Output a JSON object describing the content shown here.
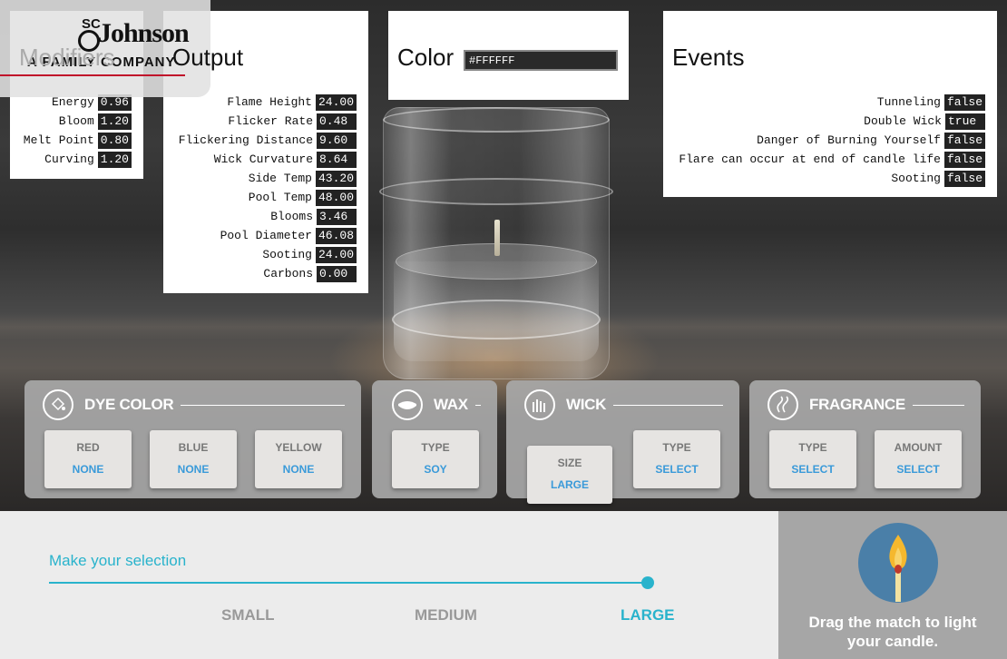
{
  "logo": {
    "sc": "SC",
    "brand": "Johnson",
    "tagline": "A FAMILY COMPANY"
  },
  "modifiers": {
    "title": "Modifiers",
    "rows": [
      {
        "label": "Energy",
        "value": "0.96"
      },
      {
        "label": "Bloom",
        "value": "1.20"
      },
      {
        "label": "Melt Point",
        "value": "0.80"
      },
      {
        "label": "Curving",
        "value": "1.20"
      }
    ]
  },
  "output": {
    "title": "Output",
    "rows": [
      {
        "label": "Flame Height",
        "value": "24.00"
      },
      {
        "label": "Flicker Rate",
        "value": "0.48"
      },
      {
        "label": "Flickering Distance",
        "value": "9.60"
      },
      {
        "label": "Wick Curvature",
        "value": "8.64"
      },
      {
        "label": "Side Temp",
        "value": "43.20"
      },
      {
        "label": "Pool Temp",
        "value": "48.00"
      },
      {
        "label": "Blooms",
        "value": "3.46"
      },
      {
        "label": "Pool Diameter",
        "value": "46.08"
      },
      {
        "label": "Sooting",
        "value": "24.00"
      },
      {
        "label": "Carbons",
        "value": "0.00"
      }
    ]
  },
  "color": {
    "title": "Color",
    "value": "#FFFFFF"
  },
  "events": {
    "title": "Events",
    "rows": [
      {
        "label": "Tunneling",
        "value": "false"
      },
      {
        "label": "Double Wick",
        "value": "true"
      },
      {
        "label": "Danger of Burning Yourself",
        "value": "false"
      },
      {
        "label": "Flare can occur at end of candle life",
        "value": "false"
      },
      {
        "label": "Sooting",
        "value": "false"
      }
    ]
  },
  "cards": {
    "dye": {
      "title": "DYE COLOR",
      "icon": "paint-bucket-icon",
      "options": [
        {
          "key": "RED",
          "value": "NONE"
        },
        {
          "key": "BLUE",
          "value": "NONE"
        },
        {
          "key": "YELLOW",
          "value": "NONE"
        }
      ]
    },
    "wax": {
      "title": "WAX",
      "icon": "wax-bowl-icon",
      "options": [
        {
          "key": "TYPE",
          "value": "SOY"
        }
      ]
    },
    "wick": {
      "title": "WICK",
      "icon": "wick-icon",
      "options": [
        {
          "key": "SIZE",
          "value": "LARGE"
        },
        {
          "key": "TYPE",
          "value": "SELECT"
        }
      ]
    },
    "fragrance": {
      "title": "FRAGRANCE",
      "icon": "fragrance-icon",
      "options": [
        {
          "key": "TYPE",
          "value": "SELECT"
        },
        {
          "key": "AMOUNT",
          "value": "SELECT"
        }
      ]
    }
  },
  "selector": {
    "prompt": "Make your selection",
    "sizes": [
      "SMALL",
      "MEDIUM",
      "LARGE"
    ],
    "selected": "LARGE"
  },
  "match": {
    "message": "Drag the match to light your candle."
  },
  "colors": {
    "accent": "#29b3cc",
    "value_blue": "#3a9ad9",
    "card_bg": "#a8a8a8",
    "match_circle": "#4a7fa8",
    "logo_red": "#c0102a"
  }
}
